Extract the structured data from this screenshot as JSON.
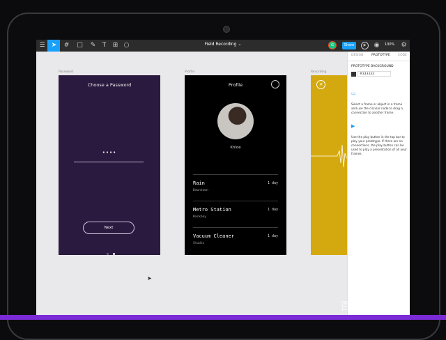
{
  "toolbar": {
    "doc_title": "Field Recording",
    "avatar_initial": "G",
    "share_label": "Share",
    "zoom": "100%",
    "accent": "#18a0fb"
  },
  "frames": {
    "password": {
      "label": "Password",
      "title": "Choose a Password",
      "masked": "••••",
      "next_label": "Next",
      "bg": "#2b1a3f"
    },
    "profile": {
      "label": "Profile",
      "title": "Profile",
      "name": "Khloe",
      "items": [
        {
          "title": "Rain",
          "sub": "Downtown",
          "time": "1 day"
        },
        {
          "title": "Metro Station",
          "sub": "Backbay",
          "time": "1 day"
        },
        {
          "title": "Vacuum Cleaner",
          "sub": "Studio",
          "time": "1 day"
        }
      ]
    },
    "recording": {
      "label": "Recording",
      "bg": "#d4a90f"
    }
  },
  "panel": {
    "tabs": [
      "DESIGN",
      "PROTOTYPE",
      "CODE"
    ],
    "active_tab": "PROTOTYPE",
    "section_title": "PROTOTYPE BACKGROUND",
    "bg_hex": "#333333",
    "help_1": "Select a frame or object in a frame and use the circular node to drag a connection to another frame.",
    "help_2": "Use the play button in the top bar to play your prototype. If there are no connections, the play button can be used to play a presentation of all your frames."
  },
  "watermark": "百家号/搜奇"
}
